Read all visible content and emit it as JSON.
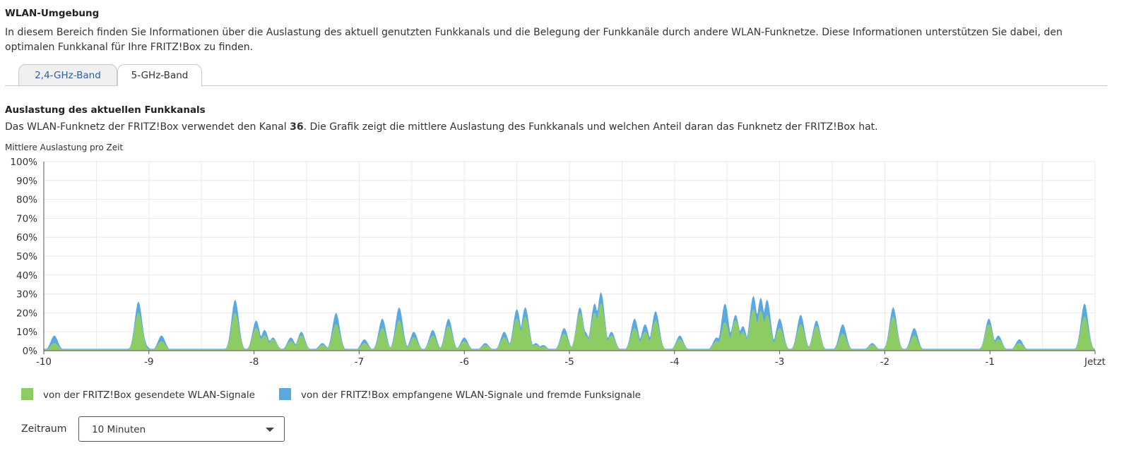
{
  "header": {
    "title": "WLAN-Umgebung",
    "intro": "In diesem Bereich finden Sie Informationen über die Auslastung des aktuell genutzten Funkkanals und die Belegung der Funkkanäle durch andere WLAN-Funknetze. Diese Informationen unterstützen Sie dabei, den optimalen Funkkanal für Ihre FRITZ!Box zu finden."
  },
  "tabs": [
    {
      "label": "2,4-GHz-Band",
      "active": false
    },
    {
      "label": "5-GHz-Band",
      "active": true
    }
  ],
  "section": {
    "title": "Auslastung des aktuellen Funkkanals",
    "text_before": "Das WLAN-Funknetz der FRITZ!Box verwendet den Kanal ",
    "channel": "36",
    "text_after": ". Die Grafik zeigt die mittlere Auslastung des Funkkanals und welchen Anteil daran das Funknetz der FRITZ!Box hat.",
    "chart_label": "Mittlere Auslastung pro Zeit"
  },
  "colors": {
    "sent": "#8dcc63",
    "received": "#5aa8e0",
    "grid": "#e8e8e8",
    "axis": "#555555"
  },
  "legend": {
    "sent_label": "von der FRITZ!Box gesendete WLAN-Signale",
    "received_label": "von der FRITZ!Box empfangene WLAN-Signale und fremde Funksignale"
  },
  "period": {
    "label": "Zeitraum",
    "selected": "10 Minuten"
  },
  "chart_data": {
    "type": "area",
    "stacked": true,
    "y_tick_labels": [
      "0%",
      "10%",
      "20%",
      "30%",
      "40%",
      "50%",
      "60%",
      "70%",
      "80%",
      "90%",
      "100%"
    ],
    "x_tick_labels": [
      "-10",
      "-9",
      "-8",
      "-7",
      "-6",
      "-5",
      "-4",
      "-3",
      "-2",
      "-1",
      "Jetzt"
    ],
    "xlim": [
      -10,
      0
    ],
    "ylim": [
      0,
      100
    ],
    "grid": true,
    "legend_position": "bottom",
    "series": [
      {
        "name": "von der FRITZ!Box gesendete WLAN-Signale",
        "color": "#8dcc63",
        "peaks": [
          [
            -9.9,
            4
          ],
          [
            -9.1,
            20
          ],
          [
            -9.05,
            2
          ],
          [
            -8.88,
            5
          ],
          [
            -8.18,
            20
          ],
          [
            -7.98,
            12
          ],
          [
            -7.9,
            8
          ],
          [
            -7.82,
            6
          ],
          [
            -7.65,
            5
          ],
          [
            -7.55,
            8
          ],
          [
            -7.35,
            3
          ],
          [
            -7.22,
            14
          ],
          [
            -6.95,
            4
          ],
          [
            -6.78,
            12
          ],
          [
            -6.62,
            16
          ],
          [
            -6.48,
            7
          ],
          [
            -6.3,
            8
          ],
          [
            -6.15,
            13
          ],
          [
            -6.0,
            5
          ],
          [
            -5.8,
            3
          ],
          [
            -5.62,
            7
          ],
          [
            -5.5,
            17
          ],
          [
            -5.42,
            18
          ],
          [
            -5.32,
            3
          ],
          [
            -5.25,
            2
          ],
          [
            -5.05,
            9
          ],
          [
            -4.9,
            20
          ],
          [
            -4.85,
            8
          ],
          [
            -4.76,
            20
          ],
          [
            -4.7,
            25
          ],
          [
            -4.6,
            8
          ],
          [
            -4.38,
            12
          ],
          [
            -4.28,
            10
          ],
          [
            -4.18,
            16
          ],
          [
            -3.95,
            6
          ],
          [
            -3.6,
            5
          ],
          [
            -3.52,
            15
          ],
          [
            -3.42,
            16
          ],
          [
            -3.35,
            10
          ],
          [
            -3.25,
            22
          ],
          [
            -3.18,
            21
          ],
          [
            -3.12,
            19
          ],
          [
            -3.0,
            12
          ],
          [
            -2.8,
            14
          ],
          [
            -2.65,
            13
          ],
          [
            -2.4,
            9
          ],
          [
            -2.12,
            3
          ],
          [
            -1.92,
            18
          ],
          [
            -1.72,
            8
          ],
          [
            -1.01,
            14
          ],
          [
            -0.92,
            6
          ],
          [
            -0.72,
            4
          ],
          [
            -0.1,
            18
          ]
        ]
      },
      {
        "name": "von der FRITZ!Box empfangene WLAN-Signale und fremde Funksignale",
        "color": "#5aa8e0",
        "peaks": [
          [
            -9.9,
            4
          ],
          [
            -9.1,
            6
          ],
          [
            -9.05,
            2
          ],
          [
            -8.88,
            3
          ],
          [
            -8.18,
            7
          ],
          [
            -7.98,
            4
          ],
          [
            -7.9,
            3
          ],
          [
            -7.82,
            1
          ],
          [
            -7.65,
            2
          ],
          [
            -7.55,
            2
          ],
          [
            -7.35,
            1
          ],
          [
            -7.22,
            6
          ],
          [
            -6.95,
            2
          ],
          [
            -6.78,
            5
          ],
          [
            -6.62,
            7
          ],
          [
            -6.48,
            3
          ],
          [
            -6.3,
            3
          ],
          [
            -6.15,
            4
          ],
          [
            -6.0,
            2
          ],
          [
            -5.8,
            1
          ],
          [
            -5.62,
            3
          ],
          [
            -5.5,
            5
          ],
          [
            -5.42,
            5
          ],
          [
            -5.32,
            1
          ],
          [
            -5.25,
            1
          ],
          [
            -5.05,
            3
          ],
          [
            -4.9,
            3
          ],
          [
            -4.85,
            2
          ],
          [
            -4.76,
            5
          ],
          [
            -4.7,
            6
          ],
          [
            -4.6,
            2
          ],
          [
            -4.38,
            5
          ],
          [
            -4.28,
            4
          ],
          [
            -4.18,
            5
          ],
          [
            -3.95,
            2
          ],
          [
            -3.6,
            2
          ],
          [
            -3.52,
            10
          ],
          [
            -3.42,
            3
          ],
          [
            -3.35,
            3
          ],
          [
            -3.25,
            7
          ],
          [
            -3.18,
            7
          ],
          [
            -3.12,
            8
          ],
          [
            -3.0,
            5
          ],
          [
            -2.8,
            5
          ],
          [
            -2.65,
            3
          ],
          [
            -2.4,
            5
          ],
          [
            -2.12,
            1
          ],
          [
            -1.92,
            5
          ],
          [
            -1.72,
            4
          ],
          [
            -1.01,
            3
          ],
          [
            -0.92,
            2
          ],
          [
            -0.72,
            2
          ],
          [
            -0.1,
            7
          ]
        ]
      }
    ]
  }
}
